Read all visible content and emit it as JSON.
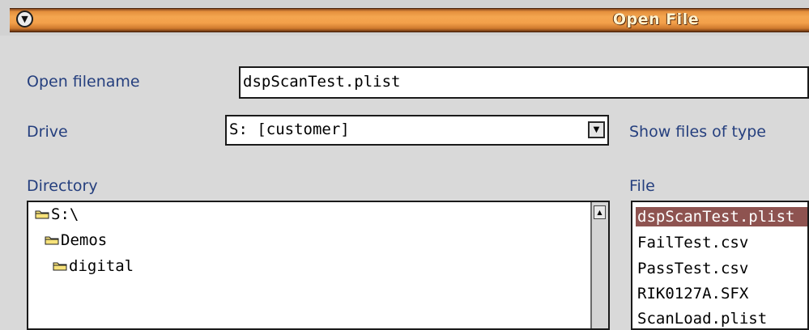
{
  "window": {
    "title": "Open File",
    "menu_icon": "chevron-down-circle-icon"
  },
  "form": {
    "open_filename_label": "Open filename",
    "open_filename_value": "dspScanTest.plist",
    "drive_label": "Drive",
    "drive_value": "S:  [customer]",
    "show_files_of_type_label": "Show files of type",
    "directory_label": "Directory",
    "file_label": "File"
  },
  "directory": {
    "items": [
      {
        "label": "S:\\",
        "icon": "folder-open-icon"
      },
      {
        "label": "Demos",
        "icon": "folder-open-icon"
      },
      {
        "label": "digital",
        "icon": "folder-open-icon"
      }
    ]
  },
  "files": {
    "items": [
      {
        "label": "dspScanTest.plist",
        "selected": true
      },
      {
        "label": "FailTest.csv",
        "selected": false
      },
      {
        "label": "PassTest.csv",
        "selected": false
      },
      {
        "label": "RIK0127A.SFX",
        "selected": false
      },
      {
        "label": "ScanLoad.plist",
        "selected": false
      }
    ]
  },
  "colors": {
    "title_bar": "#f3a04a",
    "label_text": "#253f7e",
    "selection": "#8e5350",
    "window_bg": "#d9d9d9"
  }
}
